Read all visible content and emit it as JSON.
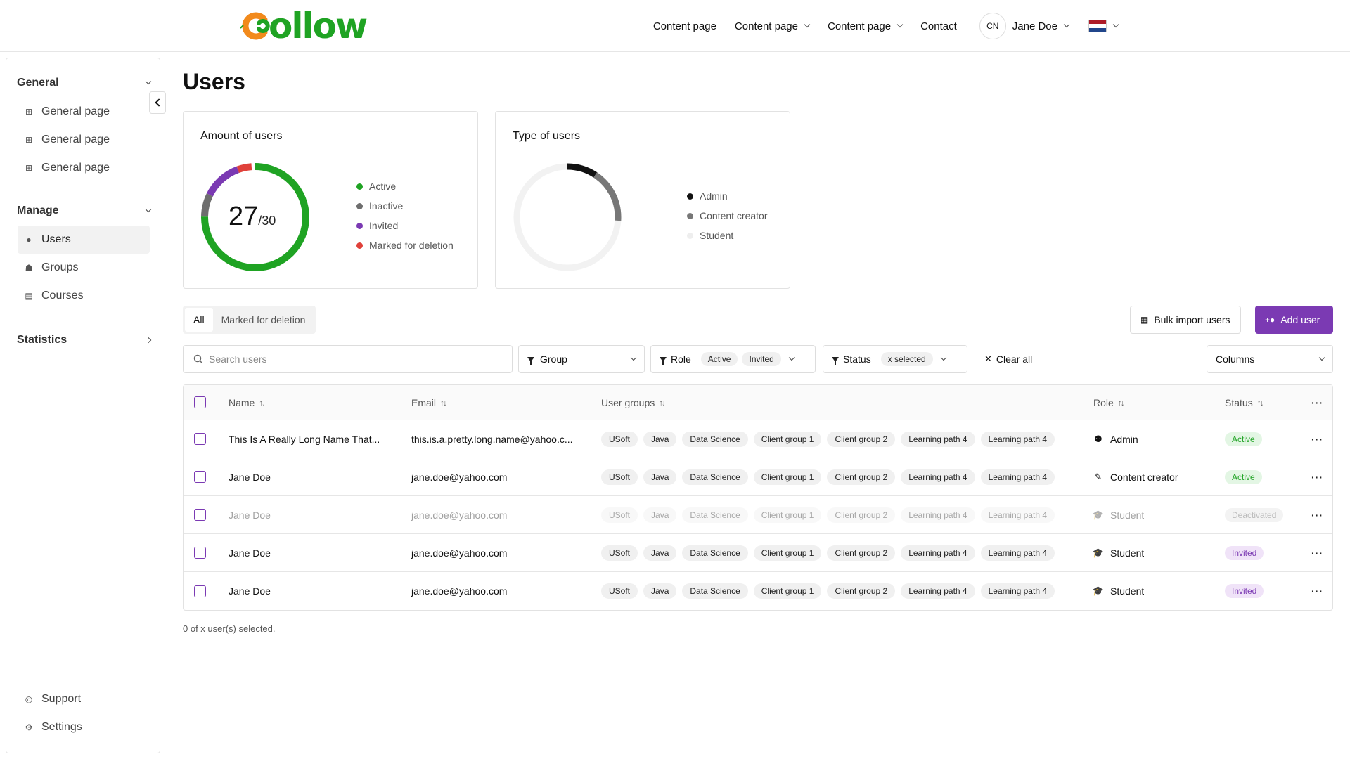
{
  "brand": {
    "logo_text": "ollow",
    "green": "#1fa323",
    "orange": "#f28a1c",
    "purple": "#7b3ab3"
  },
  "header": {
    "nav": [
      {
        "label": "Content page",
        "dropdown": false
      },
      {
        "label": "Content page",
        "dropdown": true
      },
      {
        "label": "Content page",
        "dropdown": true
      },
      {
        "label": "Contact",
        "dropdown": false
      }
    ],
    "user": {
      "initials": "CN",
      "name": "Jane Doe"
    },
    "language_flag": "netherlands-flag"
  },
  "sidebar": {
    "sections": [
      {
        "label": "General",
        "items": [
          {
            "label": "General page",
            "icon": "map-icon"
          },
          {
            "label": "General page",
            "icon": "map-icon"
          },
          {
            "label": "General page",
            "icon": "map-icon"
          }
        ]
      },
      {
        "label": "Manage",
        "items": [
          {
            "label": "Users",
            "icon": "user-icon",
            "active": true
          },
          {
            "label": "Groups",
            "icon": "groups-icon"
          },
          {
            "label": "Courses",
            "icon": "courses-icon"
          }
        ]
      },
      {
        "label": "Statistics",
        "items": []
      }
    ],
    "bottom": [
      {
        "label": "Support",
        "icon": "lifebuoy-icon"
      },
      {
        "label": "Settings",
        "icon": "gear-icon"
      }
    ]
  },
  "page": {
    "title": "Users"
  },
  "cards": {
    "amount": {
      "title": "Amount of users",
      "value": "27",
      "total": "/30",
      "legend": [
        {
          "label": "Active",
          "color": "#1fa323"
        },
        {
          "label": "Inactive",
          "color": "#6e6e6e"
        },
        {
          "label": "Invited",
          "color": "#7b3ab3"
        },
        {
          "label": "Marked for deletion",
          "color": "#e0413a"
        }
      ]
    },
    "types": {
      "title": "Type of users",
      "legend": [
        {
          "label": "Admin",
          "color": "#111111"
        },
        {
          "label": "Content creator",
          "color": "#777777"
        },
        {
          "label": "Student",
          "color": "#eeeeee"
        }
      ]
    }
  },
  "tabs": [
    {
      "label": "All",
      "active": true
    },
    {
      "label": "Marked for deletion",
      "active": false
    }
  ],
  "actions": {
    "bulk_import": "Bulk import users",
    "add_user": "Add user"
  },
  "filters": {
    "search_placeholder": "Search users",
    "group_label": "Group",
    "role_label": "Role",
    "role_chips": [
      "Active",
      "Invited"
    ],
    "status_label": "Status",
    "status_chip": "x selected",
    "clear_all": "Clear all",
    "columns_label": "Columns"
  },
  "table": {
    "headers": {
      "name": "Name",
      "email": "Email",
      "groups": "User groups",
      "role": "Role",
      "status": "Status"
    },
    "group_tags": [
      "USoft",
      "Java",
      "Data Science",
      "Client group 1",
      "Client group 2",
      "Learning path 4",
      "Learning path 4"
    ],
    "rows": [
      {
        "name": "This Is A Really Long Name That...",
        "email": "this.is.a.pretty.long.name@yahoo.c...",
        "role": "Admin",
        "role_icon": "admin-icon",
        "status": "Active",
        "status_type": "active",
        "muted": false
      },
      {
        "name": "Jane Doe",
        "email": "jane.doe@yahoo.com",
        "role": "Content creator",
        "role_icon": "pencil-icon",
        "status": "Active",
        "status_type": "active",
        "muted": false
      },
      {
        "name": "Jane Doe",
        "email": "jane.doe@yahoo.com",
        "role": "Student",
        "role_icon": "graduation-cap-icon",
        "status": "Deactivated",
        "status_type": "deact",
        "muted": true
      },
      {
        "name": "Jane Doe",
        "email": "jane.doe@yahoo.com",
        "role": "Student",
        "role_icon": "graduation-cap-icon",
        "status": "Invited",
        "status_type": "invited",
        "muted": false
      },
      {
        "name": "Jane Doe",
        "email": "jane.doe@yahoo.com",
        "role": "Student",
        "role_icon": "graduation-cap-icon",
        "status": "Invited",
        "status_type": "invited",
        "muted": false
      }
    ]
  },
  "footer_note": "0 of x user(s) selected."
}
